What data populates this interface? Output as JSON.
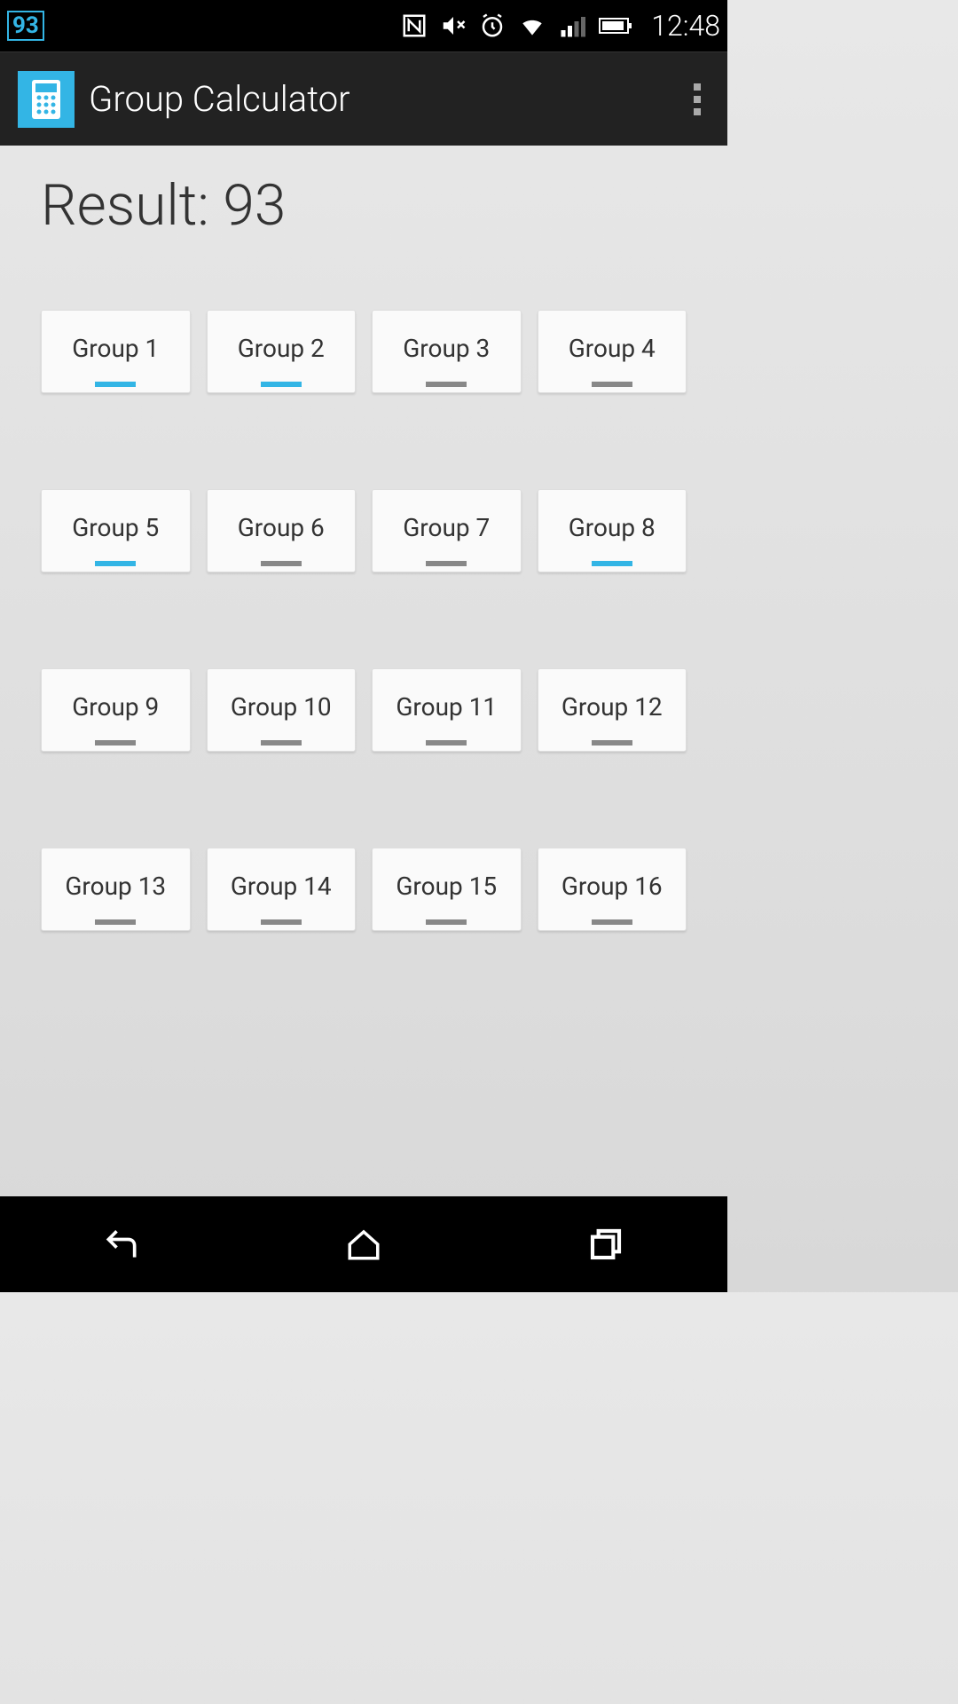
{
  "status_bar": {
    "badge": "93",
    "time": "12:48"
  },
  "action_bar": {
    "title": "Group Calculator"
  },
  "result": {
    "label": "Result: 93"
  },
  "groups": [
    {
      "label": "Group 1",
      "active": true
    },
    {
      "label": "Group 2",
      "active": true
    },
    {
      "label": "Group 3",
      "active": false
    },
    {
      "label": "Group 4",
      "active": false
    },
    {
      "label": "Group 5",
      "active": true
    },
    {
      "label": "Group 6",
      "active": false
    },
    {
      "label": "Group 7",
      "active": false
    },
    {
      "label": "Group 8",
      "active": true
    },
    {
      "label": "Group 9",
      "active": false
    },
    {
      "label": "Group 10",
      "active": false
    },
    {
      "label": "Group 11",
      "active": false
    },
    {
      "label": "Group 12",
      "active": false
    },
    {
      "label": "Group 13",
      "active": false
    },
    {
      "label": "Group 14",
      "active": false
    },
    {
      "label": "Group 15",
      "active": false
    },
    {
      "label": "Group 16",
      "active": false
    }
  ]
}
